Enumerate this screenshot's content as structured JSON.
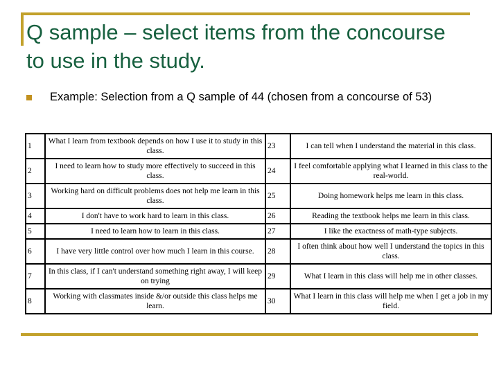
{
  "slide": {
    "title": "Q sample – select items from the concourse to use in the study.",
    "bullet": {
      "marker": "square-bullet-icon",
      "text": "Example: Selection from a Q sample of 44 (chosen from a concourse of 53)"
    },
    "colors": {
      "title_green": "#17603f",
      "accent_gold": "#c2a12b",
      "bullet_gold": "#c2911f",
      "table_border": "#000000",
      "body_text": "#000000",
      "background": "#ffffff"
    }
  },
  "table": {
    "rows": [
      {
        "left_number": "1",
        "left_statement": "What I learn from textbook depends on how I use it to study in this class.",
        "right_number": "23",
        "right_statement": "I can tell when I understand the material in this class."
      },
      {
        "left_number": "2",
        "left_statement": "I need to learn how to study more effectively to succeed in this class.",
        "right_number": "24",
        "right_statement": "I feel comfortable applying what I learned in this class to the real-world."
      },
      {
        "left_number": "3",
        "left_statement": "Working hard on difficult problems does not help me learn in this class.",
        "right_number": "25",
        "right_statement": "Doing homework helps me learn in this class."
      },
      {
        "left_number": "4",
        "left_statement": "I don't have to work hard to learn in this class.",
        "right_number": "26",
        "right_statement": "Reading the textbook helps me learn in this class."
      },
      {
        "left_number": "5",
        "left_statement": "I need to learn how to learn in this class.",
        "right_number": "27",
        "right_statement": "I like the exactness of math-type subjects."
      },
      {
        "left_number": "6",
        "left_statement": "I have very little control over how much I learn in this course.",
        "right_number": "28",
        "right_statement": "I often think about how well I understand the topics in this class."
      },
      {
        "left_number": "7",
        "left_statement": "In this class, if I can't understand something right away, I will keep on trying",
        "right_number": "29",
        "right_statement": "What I learn in this class will help me in other classes."
      },
      {
        "left_number": "8",
        "left_statement": "Working with classmates inside &/or outside this class helps me learn.",
        "right_number": "30",
        "right_statement": "What I learn in this class will help me when I get a job in my field."
      }
    ]
  }
}
